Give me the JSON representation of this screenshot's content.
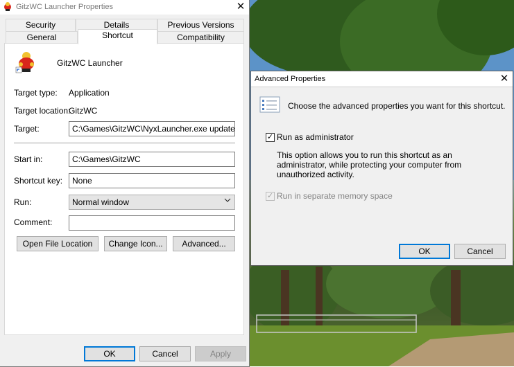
{
  "properties_window": {
    "title": "GitzWC Launcher Properties",
    "close_glyph": "✕",
    "tabs_row1": [
      "Security",
      "Details",
      "Previous Versions"
    ],
    "tabs_row2": [
      "General",
      "Shortcut",
      "Compatibility"
    ],
    "active_tab": "Shortcut",
    "app_name": "GitzWC Launcher",
    "app_icon": "gitzwc-launcher-icon",
    "target_type_label": "Target type:",
    "target_type_value": "Application",
    "target_location_label": "Target location:",
    "target_location_value": "GitzWC",
    "target_label": "Target:",
    "target_value": "C:\\Games\\GitzWC\\NyxLauncher.exe updater",
    "start_in_label": "Start in:",
    "start_in_value": "C:\\Games\\GitzWC",
    "shortcut_key_label": "Shortcut key:",
    "shortcut_key_value": "None",
    "run_label": "Run:",
    "run_value": "Normal window",
    "comment_label": "Comment:",
    "comment_value": "",
    "buttons": {
      "open_file_location": "Open File Location",
      "change_icon": "Change Icon...",
      "advanced": "Advanced..."
    },
    "footer": {
      "ok": "OK",
      "cancel": "Cancel",
      "apply": "Apply"
    }
  },
  "advanced_dialog": {
    "title": "Advanced Properties",
    "close_glyph": "✕",
    "header_text": "Choose the advanced properties you want for this shortcut.",
    "run_as_admin_label": "Run as administrator",
    "run_as_admin_checked": true,
    "description": "This option allows you to run this shortcut as an administrator, while protecting your computer from unauthorized activity.",
    "separate_memory_label": "Run in separate memory space",
    "separate_memory_checked": true,
    "separate_memory_enabled": false,
    "ok": "OK",
    "cancel": "Cancel"
  },
  "colors": {
    "accent": "#0078d7",
    "window_bg": "#f0f0f0",
    "disabled_text": "#838383"
  }
}
